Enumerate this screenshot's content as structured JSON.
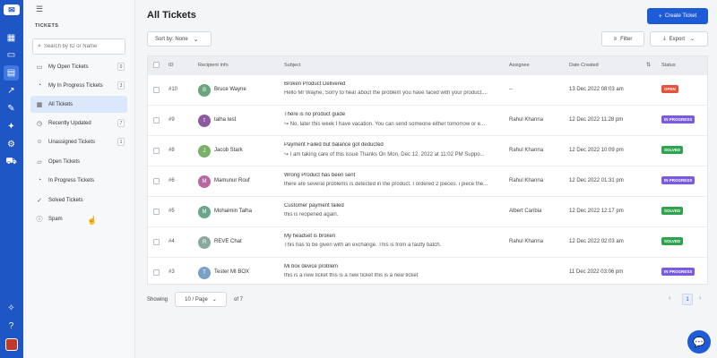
{
  "sidebar": {
    "title": "TICKETS",
    "search_placeholder": "Search by ID or Name",
    "items": [
      {
        "label": "My Open Tickets",
        "count": "0",
        "icon": "inbox-icon"
      },
      {
        "label": "My In Progress Tickets",
        "count": "3",
        "icon": "progress-icon"
      },
      {
        "label": "All Tickets",
        "count": "",
        "icon": "grid-icon"
      },
      {
        "label": "Recently Updated",
        "count": "7",
        "icon": "clock-icon"
      },
      {
        "label": "Unassigned Tickets",
        "count": "1",
        "icon": "user-icon"
      },
      {
        "label": "Open Tickets",
        "count": "",
        "icon": "folder-icon"
      },
      {
        "label": "In Progress Tickets",
        "count": "",
        "icon": "progress-icon"
      },
      {
        "label": "Solved Tickets",
        "count": "",
        "icon": "check-icon"
      },
      {
        "label": "Spam",
        "count": "",
        "icon": "alert-icon"
      }
    ]
  },
  "header": {
    "title": "All Tickets",
    "create_label": "Create Ticket"
  },
  "toolbar": {
    "sort_label": "Sort by: None",
    "filter_label": "Filter",
    "export_label": "Export"
  },
  "table": {
    "columns": {
      "id": "ID",
      "recipient": "Recipient Info",
      "subject": "Subject",
      "assignee": "Assignee",
      "date": "Date Created",
      "status": "Status"
    },
    "rows": [
      {
        "id": "#10",
        "initial": "B",
        "name": "Bruce Wayne",
        "subject": "Broken Product Delivered",
        "preview": "Hello Mr Wayne, Sorry to hear about the problem you have faced with your product....",
        "assignee": "--",
        "date": "13 Dec 2022 08:03 am",
        "status": "OPEN",
        "avatar_color": "#6aa57d",
        "status_color": "#e5533d"
      },
      {
        "id": "#9",
        "initial": "t",
        "name": "talha test",
        "subject": "There is no product guide",
        "preview": "↪ No, later this week I have vacation. You can send someone either tomorrow or e...",
        "assignee": "Rahul Khanna",
        "date": "12 Dec 2022 11:28 pm",
        "status": "IN PROGRESS",
        "avatar_color": "#8c5a9e",
        "status_color": "#7a5ae0"
      },
      {
        "id": "#8",
        "initial": "J",
        "name": "Jacob Stark",
        "subject": "Payment Failed but balance got deducted",
        "preview": "↪ I am taking care of this issue Thanks On Mon, Dec 12, 2022 at 11:02 PM Suppo...",
        "assignee": "Rahul Khanna",
        "date": "12 Dec 2022 10:09 pm",
        "status": "SOLVED",
        "avatar_color": "#7bb06a",
        "status_color": "#2ea44f"
      },
      {
        "id": "#6",
        "initial": "M",
        "name": "Mamunur Rouf",
        "subject": "Wrong Product has been sent",
        "preview": "there are several problems is detected in the product. I ordered 2 pieces. i piece the...",
        "assignee": "Rahul Khanna",
        "date": "12 Dec 2022 01:31 pm",
        "status": "IN PROGRESS",
        "avatar_color": "#b86aa0",
        "status_color": "#7a5ae0"
      },
      {
        "id": "#5",
        "initial": "M",
        "name": "Mohaimin Talha",
        "subject": "Customer payment failed",
        "preview": "this is reopened again.",
        "assignee": "Albert Caribia",
        "date": "12 Dec 2022 12:17 pm",
        "status": "SOLVED",
        "avatar_color": "#6aa58a",
        "status_color": "#2ea44f"
      },
      {
        "id": "#4",
        "initial": "R",
        "name": "REVE Chat",
        "subject": "My headset is broken",
        "preview": "This has to be given with an exchange. This is from a faulty batch.",
        "assignee": "Rahul Khanna",
        "date": "12 Dec 2022 02:03 am",
        "status": "SOLVED",
        "avatar_color": "#8aa8a0",
        "status_color": "#2ea44f"
      },
      {
        "id": "#3",
        "initial": "T",
        "name": "Tester MI BOX",
        "subject": "Mi box device problem",
        "preview": "this is a new ticket this is a new ticket this is a new ticket",
        "assignee": "",
        "date": "11 Dec 2022 03:06 pm",
        "status": "IN PROGRESS",
        "avatar_color": "#7aa0c8",
        "status_color": "#7a5ae0"
      }
    ]
  },
  "pagination": {
    "showing_label": "Showing",
    "page_size": "10 / Page",
    "of_pages": "of 7",
    "current_page": "1"
  }
}
